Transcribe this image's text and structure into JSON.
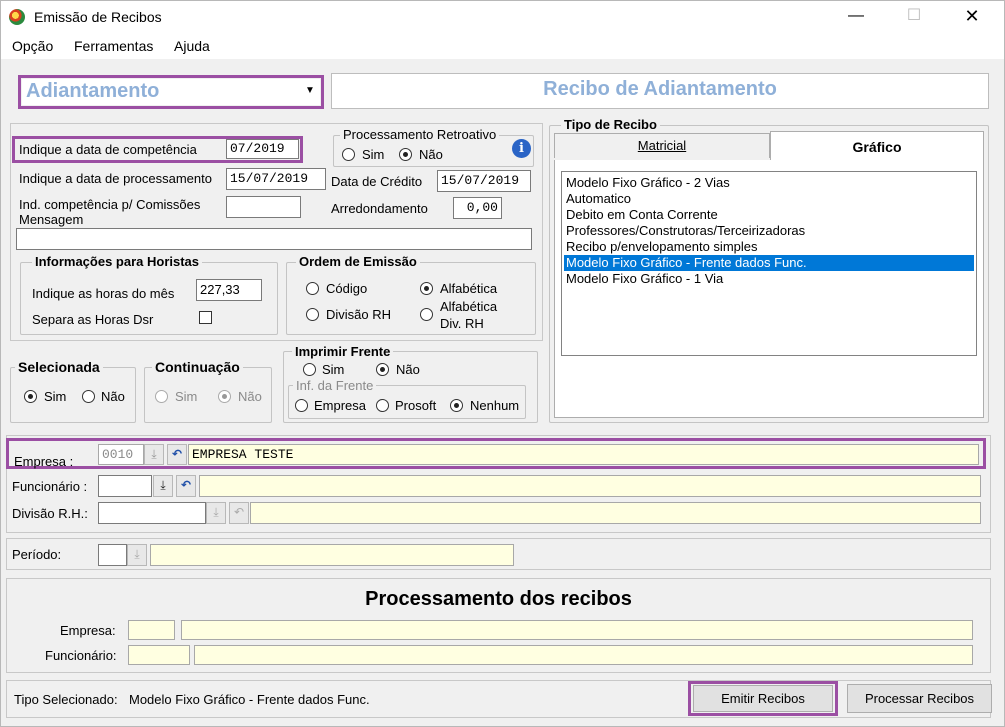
{
  "window": {
    "title": "Emissão de Recibos",
    "minimize_icon": "minimize-icon",
    "maximize_icon": "maximize-icon",
    "close_icon": "close-icon"
  },
  "menu": {
    "items": [
      "Opção",
      "Ferramentas",
      "Ajuda"
    ]
  },
  "type_select": {
    "value": "Adiantamento"
  },
  "banner": {
    "title": "Recibo de Adiantamento"
  },
  "competencia": {
    "label": "Indique a data de competência",
    "value": "07/2019"
  },
  "processamento": {
    "label": "Indique a data de processamento",
    "value": "15/07/2019"
  },
  "retroativo": {
    "title": "Processamento Retroativo",
    "sim": "Sim",
    "nao": "Não",
    "selected": "nao"
  },
  "credito": {
    "label": "Data de Crédito",
    "value": "15/07/2019"
  },
  "comissoes": {
    "label_line1": "Ind. competência p/ Comissões",
    "label_line2": "Mensagem",
    "value": ""
  },
  "arredondamento": {
    "label": "Arredondamento",
    "value": "0,00"
  },
  "mensagem": {
    "value": ""
  },
  "horistas": {
    "title": "Informações para Horistas",
    "horas_label": "Indique as horas do mês",
    "horas_value": "227,33",
    "dsr_label": "Separa as Horas Dsr"
  },
  "ordem": {
    "title": "Ordem de Emissão",
    "codigo": "Código",
    "alfabetica": "Alfabética",
    "divisao": "Divisão RH",
    "alfa_div_line1": "Alfabética",
    "alfa_div_line2": "Div. RH",
    "selected": "alfabetica"
  },
  "tipo_recibo": {
    "title": "Tipo de Recibo",
    "tabs": [
      "Matricial",
      "Gráfico"
    ],
    "active_tab": "Gráfico",
    "items": [
      "Modelo Fixo Gráfico - 2 Vias",
      "Automatico",
      "Debito em Conta Corrente",
      "Professores/Construtoras/Terceirizadoras",
      "Recibo p/envelopamento simples",
      "Modelo Fixo Gráfico - Frente dados Func.",
      "Modelo Fixo Gráfico - 1 Via"
    ],
    "selected_index": 5
  },
  "selecionada": {
    "title": "Selecionada",
    "sim": "Sim",
    "nao": "Não"
  },
  "continuacao": {
    "title": "Continuação",
    "sim": "Sim",
    "nao": "Não"
  },
  "imprimir_frente": {
    "title": "Imprimir Frente",
    "sim": "Sim",
    "nao": "Não",
    "inf_title": "Inf. da Frente",
    "empresa": "Empresa",
    "prosoft": "Prosoft",
    "nenhum": "Nenhum"
  },
  "empresa": {
    "label": "Empresa :",
    "code": "0010",
    "name": "EMPRESA TESTE"
  },
  "funcionario": {
    "label": "Funcionário :",
    "code": "",
    "name": ""
  },
  "divisao": {
    "label": "Divisão R.H.:",
    "code": "",
    "name": ""
  },
  "periodo": {
    "label": "Período:",
    "code": "",
    "name": ""
  },
  "processamento_recibos": {
    "title": "Processamento dos recibos",
    "empresa_label": "Empresa:",
    "funcionario_label": "Funcionário:"
  },
  "footer": {
    "tipo_label": "Tipo Selecionado:",
    "tipo_value": "Modelo Fixo Gráfico - Frente dados Func.",
    "emitir": "Emitir Recibos",
    "processar": "Processar Recibos"
  },
  "colors": {
    "highlight": "#9b4fa3",
    "selection": "#0078d7",
    "input_yellow": "#ffffe1",
    "banner_text": "#8fb0d8"
  }
}
